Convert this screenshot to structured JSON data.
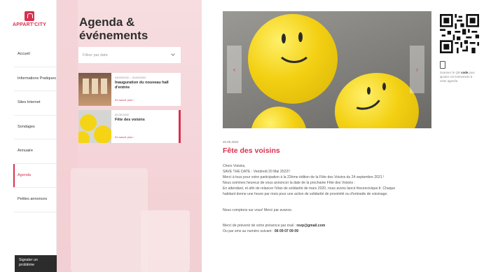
{
  "brand": {
    "name": "APPART'CITY",
    "accent": "#d8314f"
  },
  "nav": {
    "items": [
      {
        "label": "Accueil"
      },
      {
        "label": "Informations Pratiques"
      },
      {
        "label": "Sites Internet"
      },
      {
        "label": "Sondages"
      },
      {
        "label": "Annuaire"
      },
      {
        "label": "Agenda",
        "active": true
      },
      {
        "label": "Petites annonces"
      }
    ],
    "report_label": "Signaler un problème"
  },
  "agenda": {
    "title": "Agenda & événements",
    "filter_placeholder": "Filtrer par date",
    "cards": [
      {
        "date": "04/03/2022 – 31/03/2022",
        "title": "Inauguration du nouveau hall d'entrée",
        "more": "En savoir plus"
      },
      {
        "date": "20.05.2022",
        "title": "Fête des voisins",
        "more": "En savoir plus"
      }
    ],
    "watermark": "AP"
  },
  "event": {
    "date": "20.05.2022",
    "title": "Fête des voisins",
    "lines": [
      "Chers Voisins,",
      "SAVE THE DATE : Vendredi 20 Mai 2022!!",
      "Merci à tous pour votre participation à la 22ème édition de la Fête des Voisins du 24 septembre 2021 !",
      "Nous sommes heureux de vous annoncer la date de la prochaine Fête des Voisins :",
      "En attendant, et afin de relancer l'élan de solidarité de mars 2020, nous avons lancé theurecivique.fr. Chaque",
      "habitant donne une heure par mois pour une action de solidarité de proximité ou d'entraide de voisinage."
    ],
    "closing": "Nous comptons sur vous! Merci par avance.",
    "rsvp_prefix": "Merci de prévenir de votre présence par mail : ",
    "rsvp_email": "rsvp@gmail.com",
    "phone_prefix": "Ou par sms au numéro suivant : ",
    "phone": "06 09 07 09 09"
  },
  "qr": {
    "text_pre": "Scannez le QR",
    "text_bold": "code",
    "text_post": "pour ajouter cet événement à votre agenda"
  },
  "carousel": {
    "prev_icon": "chevron-left-icon",
    "next_icon": "chevron-right-icon"
  }
}
